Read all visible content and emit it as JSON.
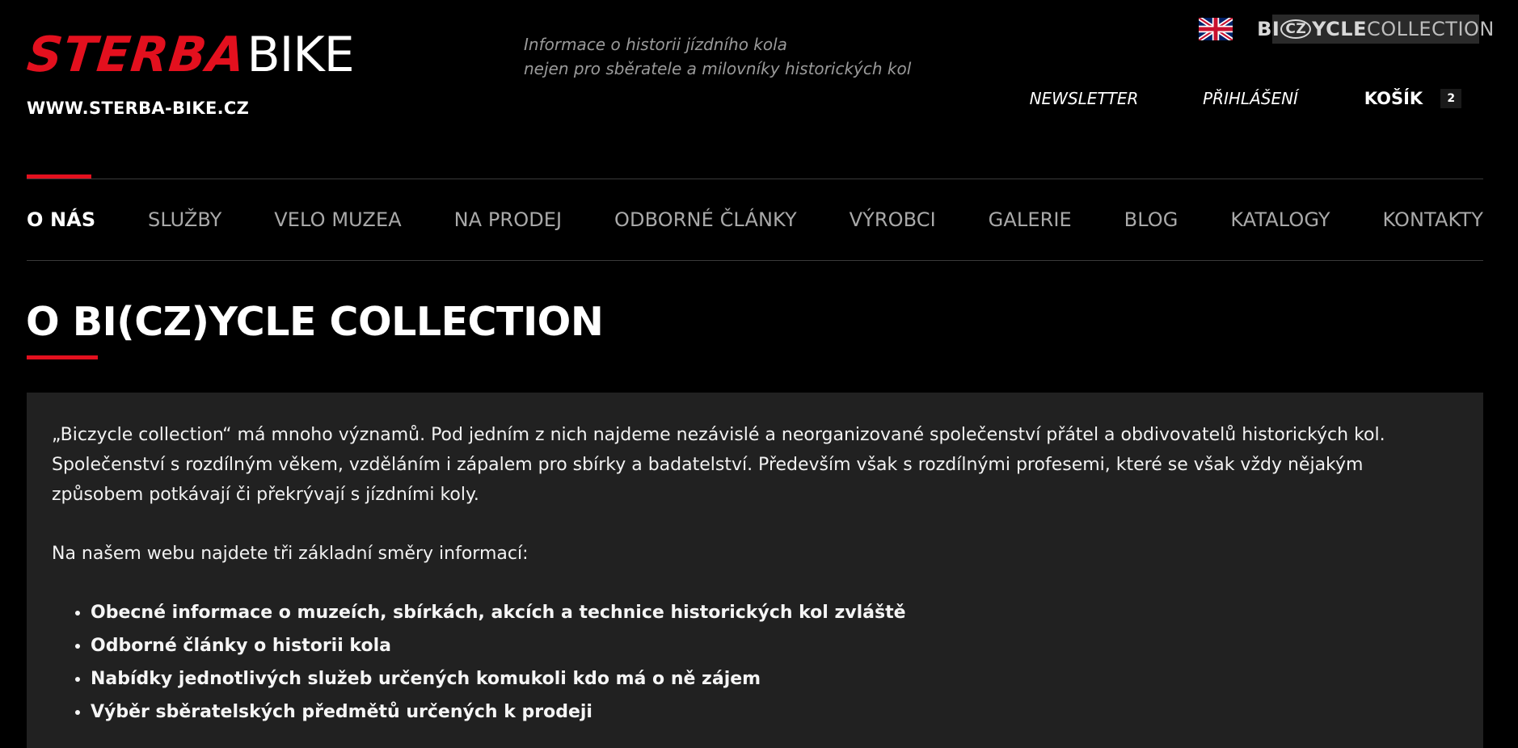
{
  "header": {
    "logo_red": "STERBA",
    "logo_white": "BIKE",
    "site_url": "WWW.STERBA-BIKE.CZ",
    "tagline_line1": "Informace o historii jízdního kola",
    "tagline_line2": "nejen pro sběratele a milovníky historických kol",
    "language_flag_icon": "uk-flag-icon",
    "brand_badge": {
      "prefix": "BI",
      "circle": "CZ",
      "suffix_bold": "YCLE",
      "suffix": " COLLECTION"
    },
    "buttons": {
      "newsletter": "NEWSLETTER",
      "login": "PŘIHLÁŠENÍ",
      "cart": "KOŠÍK",
      "cart_count": "2"
    }
  },
  "nav": {
    "items": [
      {
        "label": "O NÁS",
        "active": true
      },
      {
        "label": "SLUŽBY"
      },
      {
        "label": "VELO MUZEA"
      },
      {
        "label": "NA PRODEJ"
      },
      {
        "label": "ODBORNÉ ČLÁNKY"
      },
      {
        "label": "VÝROBCI"
      },
      {
        "label": "GALERIE"
      },
      {
        "label": "BLOG"
      },
      {
        "label": "KATALOGY"
      },
      {
        "label": "KONTAKTY"
      }
    ]
  },
  "main": {
    "title": "O BI(CZ)YCLE COLLECTION",
    "paragraph1": "„Biczycle collection“ má mnoho významů. Pod jedním z nich najdeme nezávislé a neorganizované společenství přátel a obdivovatelů historických kol. Společenství s rozdílným věkem, vzděláním i zápalem pro sbírky a badatelství. Především však s rozdílnými profesemi, které se však vždy nějakým způsobem potkávají či překrývají s jízdními koly.",
    "paragraph2": "Na našem webu najdete tři základní směry informací:",
    "list": [
      "Obecné informace o muzeích, sbírkách, akcích a technice historických kol zvláště",
      "Odborné články o historii kola",
      "Nabídky jednotlivých služeb určených komukoli kdo má o ně zájem",
      "Výběr sběratelských předmětů určených k prodeji"
    ]
  },
  "colors": {
    "accent": "#e3101e",
    "panel": "#212121",
    "background": "#000000",
    "nav_inactive": "#a9a9a9"
  }
}
